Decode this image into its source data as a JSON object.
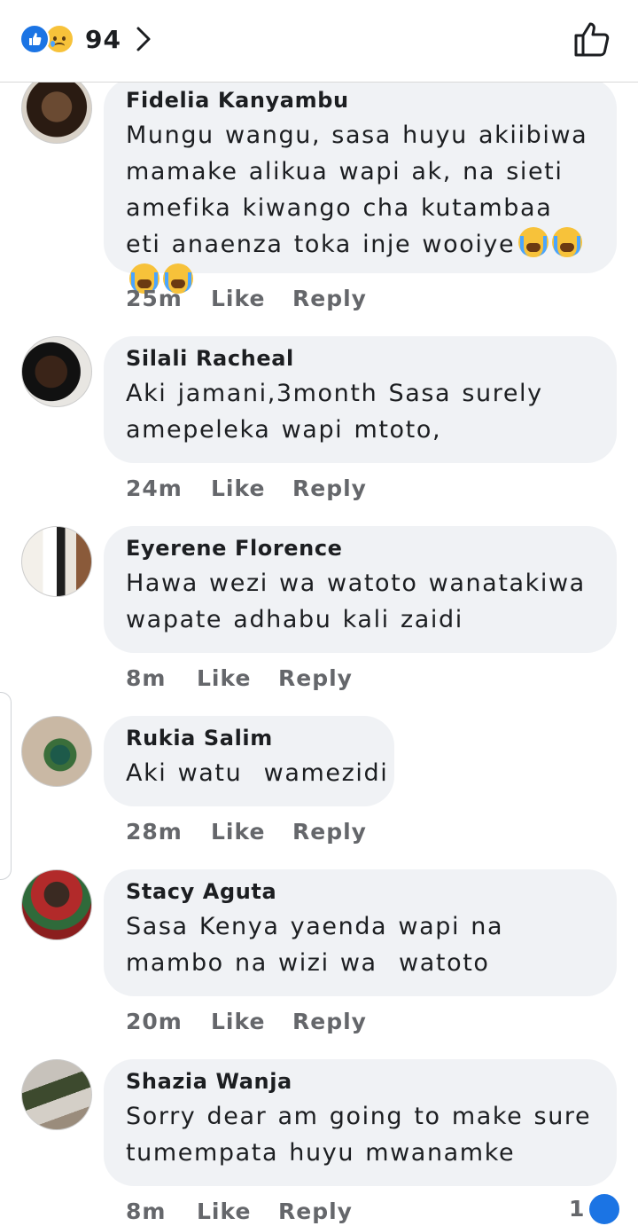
{
  "header": {
    "reaction_count": "94",
    "reaction_icons": [
      "like-icon",
      "sad-icon"
    ],
    "chevron_icon": "chevron-right-icon",
    "like_button_icon": "thumbs-up-outline-icon"
  },
  "comments": [
    {
      "name": "Fidelia Kanyambu",
      "text": "Mungu wangu, sasa huyu akiibiwa mamake alikua wapi ak, na sieti amefika kiwango cha kutambaa eti anaenza toka inje wooiye",
      "emoji": [
        "loudly-crying-face",
        "loudly-crying-face",
        "loudly-crying-face",
        "loudly-crying-face"
      ],
      "time": "25m",
      "like": "Like",
      "reply": "Reply"
    },
    {
      "name": "Silali Racheal",
      "text": "Aki jamani,3month Sasa surely amepeleka wapi mtoto,",
      "time": "24m",
      "like": "Like",
      "reply": "Reply"
    },
    {
      "name": "Eyerene Florence",
      "text": "Hawa wezi wa watoto wanatakiwa wapate adhabu kali zaidi",
      "time": "8m",
      "like": "Like",
      "reply": "Reply"
    },
    {
      "name": "Rukia Salim",
      "text": "Aki watu  wamezidi",
      "time": "28m",
      "like": "Like",
      "reply": "Reply"
    },
    {
      "name": "Stacy Aguta",
      "text": "Sasa Kenya yaenda wapi na mambo na wizi wa  watoto",
      "time": "20m",
      "like": "Like",
      "reply": "Reply"
    },
    {
      "name": "Shazia Wanja",
      "text": "Sorry dear am going to make sure tumempata huyu mwanamke",
      "time": "8m",
      "like": "Like",
      "reply": "Reply",
      "reaction_count": "1"
    }
  ],
  "colors": {
    "bubble": "#f0f2f5",
    "accent": "#1b74e4",
    "meta_text": "#65676b"
  }
}
